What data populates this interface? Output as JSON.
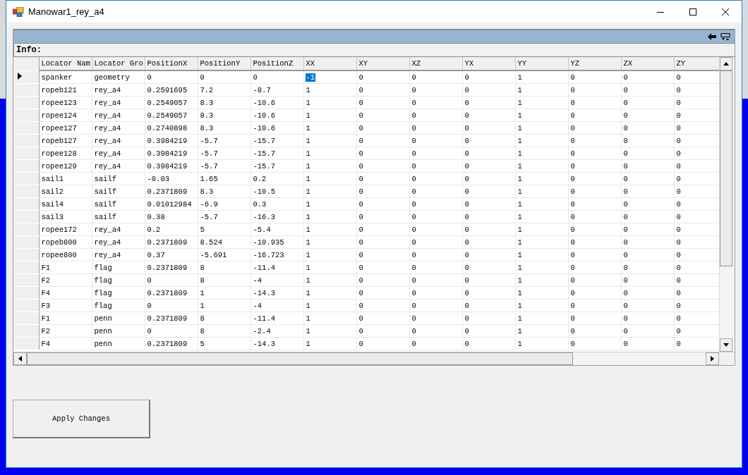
{
  "window": {
    "title": "Manowar1_rey_a4"
  },
  "grid": {
    "caption": "Info:",
    "columns": [
      "Locator Nam",
      "Locator Gro",
      "PositionX",
      "PositionY",
      "PositionZ",
      "XX",
      "XY",
      "XZ",
      "YX",
      "YY",
      "YZ",
      "ZX",
      "ZY"
    ],
    "rows": [
      {
        "current": true,
        "cells": [
          {
            "text": "spanker",
            "selected": false
          },
          {
            "text": "geometry",
            "selected": false
          },
          {
            "text": "0",
            "selected": false
          },
          {
            "text": "0",
            "selected": false
          },
          {
            "text": "0",
            "selected": false
          },
          {
            "text": "-1",
            "selected": true
          },
          {
            "text": "0",
            "selected": false
          },
          {
            "text": "0",
            "selected": false
          },
          {
            "text": "0",
            "selected": false
          },
          {
            "text": "1",
            "selected": false
          },
          {
            "text": "0",
            "selected": false
          },
          {
            "text": "0",
            "selected": false
          },
          {
            "text": "0",
            "selected": false
          }
        ]
      },
      {
        "current": false,
        "cells": [
          {
            "text": "ropeb121",
            "selected": false
          },
          {
            "text": "rey_a4",
            "selected": false
          },
          {
            "text": "0.2591695",
            "selected": false
          },
          {
            "text": "7.2",
            "selected": false
          },
          {
            "text": "-8.7",
            "selected": false
          },
          {
            "text": "1",
            "selected": false
          },
          {
            "text": "0",
            "selected": false
          },
          {
            "text": "0",
            "selected": false
          },
          {
            "text": "0",
            "selected": false
          },
          {
            "text": "1",
            "selected": false
          },
          {
            "text": "0",
            "selected": false
          },
          {
            "text": "0",
            "selected": false
          },
          {
            "text": "0",
            "selected": false
          }
        ]
      },
      {
        "current": false,
        "cells": [
          {
            "text": "ropee123",
            "selected": false
          },
          {
            "text": "rey_a4",
            "selected": false
          },
          {
            "text": "0.2549057",
            "selected": false
          },
          {
            "text": "8.3",
            "selected": false
          },
          {
            "text": "-10.6",
            "selected": false
          },
          {
            "text": "1",
            "selected": false
          },
          {
            "text": "0",
            "selected": false
          },
          {
            "text": "0",
            "selected": false
          },
          {
            "text": "0",
            "selected": false
          },
          {
            "text": "1",
            "selected": false
          },
          {
            "text": "0",
            "selected": false
          },
          {
            "text": "0",
            "selected": false
          },
          {
            "text": "0",
            "selected": false
          }
        ]
      },
      {
        "current": false,
        "cells": [
          {
            "text": "ropee124",
            "selected": false
          },
          {
            "text": "rey_a4",
            "selected": false
          },
          {
            "text": "0.2549057",
            "selected": false
          },
          {
            "text": "8.3",
            "selected": false
          },
          {
            "text": "-10.6",
            "selected": false
          },
          {
            "text": "1",
            "selected": false
          },
          {
            "text": "0",
            "selected": false
          },
          {
            "text": "0",
            "selected": false
          },
          {
            "text": "0",
            "selected": false
          },
          {
            "text": "1",
            "selected": false
          },
          {
            "text": "0",
            "selected": false
          },
          {
            "text": "0",
            "selected": false
          },
          {
            "text": "0",
            "selected": false
          }
        ]
      },
      {
        "current": false,
        "cells": [
          {
            "text": "ropee127",
            "selected": false
          },
          {
            "text": "rey_a4",
            "selected": false
          },
          {
            "text": "0.2740898",
            "selected": false
          },
          {
            "text": "8.3",
            "selected": false
          },
          {
            "text": "-10.6",
            "selected": false
          },
          {
            "text": "1",
            "selected": false
          },
          {
            "text": "0",
            "selected": false
          },
          {
            "text": "0",
            "selected": false
          },
          {
            "text": "0",
            "selected": false
          },
          {
            "text": "1",
            "selected": false
          },
          {
            "text": "0",
            "selected": false
          },
          {
            "text": "0",
            "selected": false
          },
          {
            "text": "0",
            "selected": false
          }
        ]
      },
      {
        "current": false,
        "cells": [
          {
            "text": "ropeb127",
            "selected": false
          },
          {
            "text": "rey_a4",
            "selected": false
          },
          {
            "text": "0.3984219",
            "selected": false
          },
          {
            "text": "-5.7",
            "selected": false
          },
          {
            "text": "-15.7",
            "selected": false
          },
          {
            "text": "1",
            "selected": false
          },
          {
            "text": "0",
            "selected": false
          },
          {
            "text": "0",
            "selected": false
          },
          {
            "text": "0",
            "selected": false
          },
          {
            "text": "1",
            "selected": false
          },
          {
            "text": "0",
            "selected": false
          },
          {
            "text": "0",
            "selected": false
          },
          {
            "text": "0",
            "selected": false
          }
        ]
      },
      {
        "current": false,
        "cells": [
          {
            "text": "ropee128",
            "selected": false
          },
          {
            "text": "rey_a4",
            "selected": false
          },
          {
            "text": "0.3984219",
            "selected": false
          },
          {
            "text": "-5.7",
            "selected": false
          },
          {
            "text": "-15.7",
            "selected": false
          },
          {
            "text": "1",
            "selected": false
          },
          {
            "text": "0",
            "selected": false
          },
          {
            "text": "0",
            "selected": false
          },
          {
            "text": "0",
            "selected": false
          },
          {
            "text": "1",
            "selected": false
          },
          {
            "text": "0",
            "selected": false
          },
          {
            "text": "0",
            "selected": false
          },
          {
            "text": "0",
            "selected": false
          }
        ]
      },
      {
        "current": false,
        "cells": [
          {
            "text": "ropee129",
            "selected": false
          },
          {
            "text": "rey_a4",
            "selected": false
          },
          {
            "text": "0.3984219",
            "selected": false
          },
          {
            "text": "-5.7",
            "selected": false
          },
          {
            "text": "-15.7",
            "selected": false
          },
          {
            "text": "1",
            "selected": false
          },
          {
            "text": "0",
            "selected": false
          },
          {
            "text": "0",
            "selected": false
          },
          {
            "text": "0",
            "selected": false
          },
          {
            "text": "1",
            "selected": false
          },
          {
            "text": "0",
            "selected": false
          },
          {
            "text": "0",
            "selected": false
          },
          {
            "text": "0",
            "selected": false
          }
        ]
      },
      {
        "current": false,
        "cells": [
          {
            "text": "sail1",
            "selected": false
          },
          {
            "text": "sailf",
            "selected": false
          },
          {
            "text": "-0.03",
            "selected": false
          },
          {
            "text": "1.65",
            "selected": false
          },
          {
            "text": "0.2",
            "selected": false
          },
          {
            "text": "1",
            "selected": false
          },
          {
            "text": "0",
            "selected": false
          },
          {
            "text": "0",
            "selected": false
          },
          {
            "text": "0",
            "selected": false
          },
          {
            "text": "1",
            "selected": false
          },
          {
            "text": "0",
            "selected": false
          },
          {
            "text": "0",
            "selected": false
          },
          {
            "text": "0",
            "selected": false
          }
        ]
      },
      {
        "current": false,
        "cells": [
          {
            "text": "sail2",
            "selected": false
          },
          {
            "text": "sailf",
            "selected": false
          },
          {
            "text": "0.2371809",
            "selected": false
          },
          {
            "text": "8.3",
            "selected": false
          },
          {
            "text": "-10.5",
            "selected": false
          },
          {
            "text": "1",
            "selected": false
          },
          {
            "text": "0",
            "selected": false
          },
          {
            "text": "0",
            "selected": false
          },
          {
            "text": "0",
            "selected": false
          },
          {
            "text": "1",
            "selected": false
          },
          {
            "text": "0",
            "selected": false
          },
          {
            "text": "0",
            "selected": false
          },
          {
            "text": "0",
            "selected": false
          }
        ]
      },
      {
        "current": false,
        "cells": [
          {
            "text": "sail4",
            "selected": false
          },
          {
            "text": "sailf",
            "selected": false
          },
          {
            "text": "0.01012984",
            "selected": false
          },
          {
            "text": "-6.9",
            "selected": false
          },
          {
            "text": "0.3",
            "selected": false
          },
          {
            "text": "1",
            "selected": false
          },
          {
            "text": "0",
            "selected": false
          },
          {
            "text": "0",
            "selected": false
          },
          {
            "text": "0",
            "selected": false
          },
          {
            "text": "1",
            "selected": false
          },
          {
            "text": "0",
            "selected": false
          },
          {
            "text": "0",
            "selected": false
          },
          {
            "text": "0",
            "selected": false
          }
        ]
      },
      {
        "current": false,
        "cells": [
          {
            "text": "sail3",
            "selected": false
          },
          {
            "text": "sailf",
            "selected": false
          },
          {
            "text": "0.38",
            "selected": false
          },
          {
            "text": "-5.7",
            "selected": false
          },
          {
            "text": "-16.3",
            "selected": false
          },
          {
            "text": "1",
            "selected": false
          },
          {
            "text": "0",
            "selected": false
          },
          {
            "text": "0",
            "selected": false
          },
          {
            "text": "0",
            "selected": false
          },
          {
            "text": "1",
            "selected": false
          },
          {
            "text": "0",
            "selected": false
          },
          {
            "text": "0",
            "selected": false
          },
          {
            "text": "0",
            "selected": false
          }
        ]
      },
      {
        "current": false,
        "cells": [
          {
            "text": "ropee172",
            "selected": false
          },
          {
            "text": "rey_a4",
            "selected": false
          },
          {
            "text": "0.2",
            "selected": false
          },
          {
            "text": "5",
            "selected": false
          },
          {
            "text": "-5.4",
            "selected": false
          },
          {
            "text": "1",
            "selected": false
          },
          {
            "text": "0",
            "selected": false
          },
          {
            "text": "0",
            "selected": false
          },
          {
            "text": "0",
            "selected": false
          },
          {
            "text": "1",
            "selected": false
          },
          {
            "text": "0",
            "selected": false
          },
          {
            "text": "0",
            "selected": false
          },
          {
            "text": "0",
            "selected": false
          }
        ]
      },
      {
        "current": false,
        "cells": [
          {
            "text": "ropeb800",
            "selected": false
          },
          {
            "text": "rey_a4",
            "selected": false
          },
          {
            "text": "0.2371809",
            "selected": false
          },
          {
            "text": "8.524",
            "selected": false
          },
          {
            "text": "-10.935",
            "selected": false
          },
          {
            "text": "1",
            "selected": false
          },
          {
            "text": "0",
            "selected": false
          },
          {
            "text": "0",
            "selected": false
          },
          {
            "text": "0",
            "selected": false
          },
          {
            "text": "1",
            "selected": false
          },
          {
            "text": "0",
            "selected": false
          },
          {
            "text": "0",
            "selected": false
          },
          {
            "text": "0",
            "selected": false
          }
        ]
      },
      {
        "current": false,
        "cells": [
          {
            "text": "ropee800",
            "selected": false
          },
          {
            "text": "rey_a4",
            "selected": false
          },
          {
            "text": "0.37",
            "selected": false
          },
          {
            "text": "-5.691",
            "selected": false
          },
          {
            "text": "-16.723",
            "selected": false
          },
          {
            "text": "1",
            "selected": false
          },
          {
            "text": "0",
            "selected": false
          },
          {
            "text": "0",
            "selected": false
          },
          {
            "text": "0",
            "selected": false
          },
          {
            "text": "1",
            "selected": false
          },
          {
            "text": "0",
            "selected": false
          },
          {
            "text": "0",
            "selected": false
          },
          {
            "text": "0",
            "selected": false
          }
        ]
      },
      {
        "current": false,
        "cells": [
          {
            "text": "F1",
            "selected": false
          },
          {
            "text": "flag",
            "selected": false
          },
          {
            "text": "0.2371809",
            "selected": false
          },
          {
            "text": "8",
            "selected": false
          },
          {
            "text": "-11.4",
            "selected": false
          },
          {
            "text": "1",
            "selected": false
          },
          {
            "text": "0",
            "selected": false
          },
          {
            "text": "0",
            "selected": false
          },
          {
            "text": "0",
            "selected": false
          },
          {
            "text": "1",
            "selected": false
          },
          {
            "text": "0",
            "selected": false
          },
          {
            "text": "0",
            "selected": false
          },
          {
            "text": "0",
            "selected": false
          }
        ]
      },
      {
        "current": false,
        "cells": [
          {
            "text": "F2",
            "selected": false
          },
          {
            "text": "flag",
            "selected": false
          },
          {
            "text": "0",
            "selected": false
          },
          {
            "text": "8",
            "selected": false
          },
          {
            "text": "-4",
            "selected": false
          },
          {
            "text": "1",
            "selected": false
          },
          {
            "text": "0",
            "selected": false
          },
          {
            "text": "0",
            "selected": false
          },
          {
            "text": "0",
            "selected": false
          },
          {
            "text": "1",
            "selected": false
          },
          {
            "text": "0",
            "selected": false
          },
          {
            "text": "0",
            "selected": false
          },
          {
            "text": "0",
            "selected": false
          }
        ]
      },
      {
        "current": false,
        "cells": [
          {
            "text": "F4",
            "selected": false
          },
          {
            "text": "flag",
            "selected": false
          },
          {
            "text": "0.2371809",
            "selected": false
          },
          {
            "text": "1",
            "selected": false
          },
          {
            "text": "-14.3",
            "selected": false
          },
          {
            "text": "1",
            "selected": false
          },
          {
            "text": "0",
            "selected": false
          },
          {
            "text": "0",
            "selected": false
          },
          {
            "text": "0",
            "selected": false
          },
          {
            "text": "1",
            "selected": false
          },
          {
            "text": "0",
            "selected": false
          },
          {
            "text": "0",
            "selected": false
          },
          {
            "text": "0",
            "selected": false
          }
        ]
      },
      {
        "current": false,
        "cells": [
          {
            "text": "F3",
            "selected": false
          },
          {
            "text": "flag",
            "selected": false
          },
          {
            "text": "0",
            "selected": false
          },
          {
            "text": "1",
            "selected": false
          },
          {
            "text": "-4",
            "selected": false
          },
          {
            "text": "1",
            "selected": false
          },
          {
            "text": "0",
            "selected": false
          },
          {
            "text": "0",
            "selected": false
          },
          {
            "text": "0",
            "selected": false
          },
          {
            "text": "1",
            "selected": false
          },
          {
            "text": "0",
            "selected": false
          },
          {
            "text": "0",
            "selected": false
          },
          {
            "text": "0",
            "selected": false
          }
        ]
      },
      {
        "current": false,
        "cells": [
          {
            "text": "F1",
            "selected": false
          },
          {
            "text": "penn",
            "selected": false
          },
          {
            "text": "0.2371809",
            "selected": false
          },
          {
            "text": "8",
            "selected": false
          },
          {
            "text": "-11.4",
            "selected": false
          },
          {
            "text": "1",
            "selected": false
          },
          {
            "text": "0",
            "selected": false
          },
          {
            "text": "0",
            "selected": false
          },
          {
            "text": "0",
            "selected": false
          },
          {
            "text": "1",
            "selected": false
          },
          {
            "text": "0",
            "selected": false
          },
          {
            "text": "0",
            "selected": false
          },
          {
            "text": "0",
            "selected": false
          }
        ]
      },
      {
        "current": false,
        "cells": [
          {
            "text": "F2",
            "selected": false
          },
          {
            "text": "penn",
            "selected": false
          },
          {
            "text": "0",
            "selected": false
          },
          {
            "text": "8",
            "selected": false
          },
          {
            "text": "-2.4",
            "selected": false
          },
          {
            "text": "1",
            "selected": false
          },
          {
            "text": "0",
            "selected": false
          },
          {
            "text": "0",
            "selected": false
          },
          {
            "text": "0",
            "selected": false
          },
          {
            "text": "1",
            "selected": false
          },
          {
            "text": "0",
            "selected": false
          },
          {
            "text": "0",
            "selected": false
          },
          {
            "text": "0",
            "selected": false
          }
        ]
      },
      {
        "current": false,
        "cells": [
          {
            "text": "F4",
            "selected": false
          },
          {
            "text": "penn",
            "selected": false
          },
          {
            "text": "0.2371809",
            "selected": false
          },
          {
            "text": "5",
            "selected": false
          },
          {
            "text": "-14.3",
            "selected": false
          },
          {
            "text": "1",
            "selected": false
          },
          {
            "text": "0",
            "selected": false
          },
          {
            "text": "0",
            "selected": false
          },
          {
            "text": "0",
            "selected": false
          },
          {
            "text": "1",
            "selected": false
          },
          {
            "text": "0",
            "selected": false
          },
          {
            "text": "0",
            "selected": false
          },
          {
            "text": "0",
            "selected": false
          }
        ]
      }
    ]
  },
  "buttons": [
    {
      "label": "Apply Changes"
    }
  ]
}
